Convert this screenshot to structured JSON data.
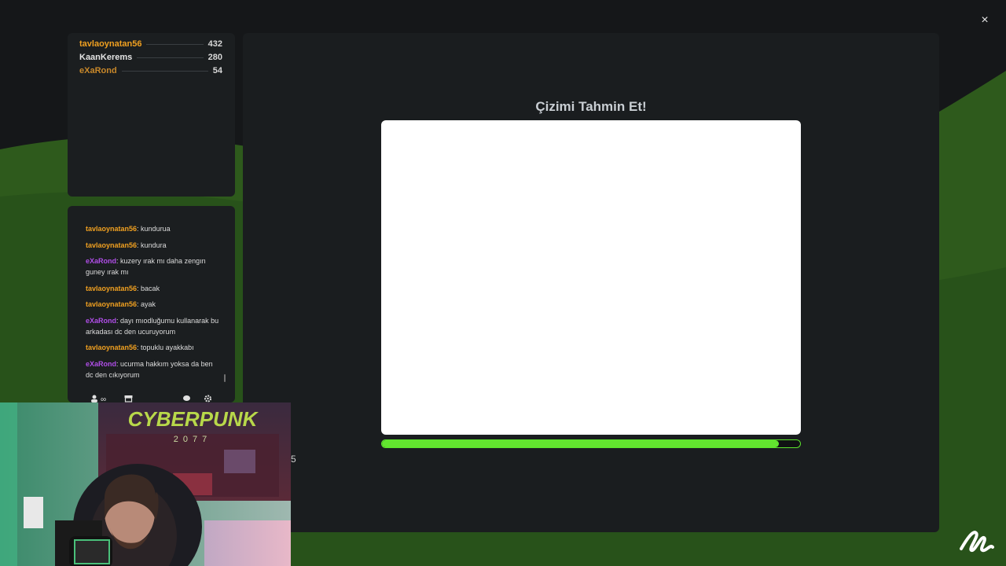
{
  "colors": {
    "accent_green": "#62e52f",
    "user_orange": "#f0a020",
    "user_purple": "#b04ee8",
    "user_gold": "#c8882a"
  },
  "header": {
    "close_icon": "×"
  },
  "scoreboard": {
    "players": [
      {
        "name": "tavlaoynatan56",
        "score": "432",
        "color": "#f0a020"
      },
      {
        "name": "KaanKerems",
        "score": "280",
        "color": "#e4e4e4"
      },
      {
        "name": "eXaRond",
        "score": "54",
        "color": "#c8882a"
      }
    ]
  },
  "chat": {
    "messages": [
      {
        "user": "tavlaoynatan56",
        "sep": ":",
        "text": " kundurua"
      },
      {
        "user": "tavlaoynatan56",
        "sep": ":",
        "text": " kundura"
      },
      {
        "user": "eXaRond",
        "sep": ":",
        "text": " kuzery ırak mı daha zengın guney ırak mı"
      },
      {
        "user": "tavlaoynatan56",
        "sep": ":",
        "text": " bacak"
      },
      {
        "user": "tavlaoynatan56",
        "sep": ":",
        "text": " ayak"
      },
      {
        "user": "eXaRond",
        "sep": ":",
        "text": " dayı mıodluğumu kullanarak bu arkadası dc den ucuruyorum"
      },
      {
        "user": "tavlaoynatan56",
        "sep": ":",
        "text": " topuklu ayakkabı"
      },
      {
        "user": "eXaRond",
        "sep": ":",
        "text": " ucurma hakkım yoksa da ben dc den cıkıyorum"
      }
    ],
    "toolbar": {
      "players_icon": "players-icon",
      "infinity_label": "∞",
      "shop_icon": "shop-icon",
      "chat_icon": "chat-bubble-icon",
      "settings_icon": "gear-icon"
    }
  },
  "game": {
    "title": "Çizimi Tahmin Et!",
    "timer_progress": 0.95
  },
  "webcam": {
    "poster_text": "CYBERPUNK",
    "poster_year": "2077",
    "side_digit": "5"
  },
  "brand": {
    "logo_icon": "scribble-logo-icon"
  }
}
